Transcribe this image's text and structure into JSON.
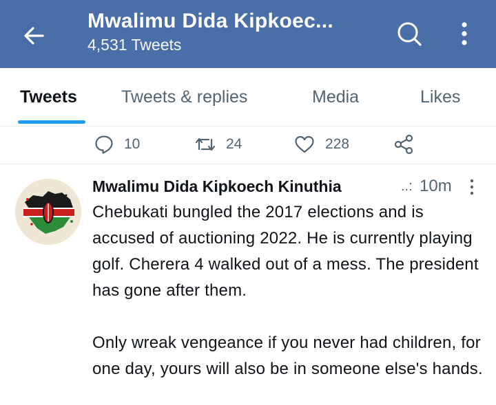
{
  "header": {
    "title": "Mwalimu Dida Kipkoec...",
    "tweet_count": "4,531 Tweets",
    "icons": [
      "back-arrow-icon",
      "search-icon",
      "more-vertical-icon"
    ]
  },
  "tabs": [
    {
      "label": "Tweets",
      "active": true
    },
    {
      "label": "Tweets & replies",
      "active": false
    },
    {
      "label": "Media",
      "active": false
    },
    {
      "label": "Likes",
      "active": false
    }
  ],
  "previous_tweet_actions": {
    "replies": "10",
    "retweets": "24",
    "likes": "228"
  },
  "tweet": {
    "author": "Mwalimu Dida Kipkoech Kinuthia",
    "separator": "..:",
    "time": "10m",
    "paragraphs": [
      "Chebukati bungled the 2017 elections and is accused of auctioning 2022. He is currently playing golf. Cherera 4 walked out of a mess. The president has gone after them.",
      "Only wreak vengeance if you never had children, for one day, yours will also be in someone else's hands."
    ]
  },
  "colors": {
    "header_bg": "#4a6ea8",
    "accent": "#1d9bf0",
    "muted_text": "#536471"
  }
}
